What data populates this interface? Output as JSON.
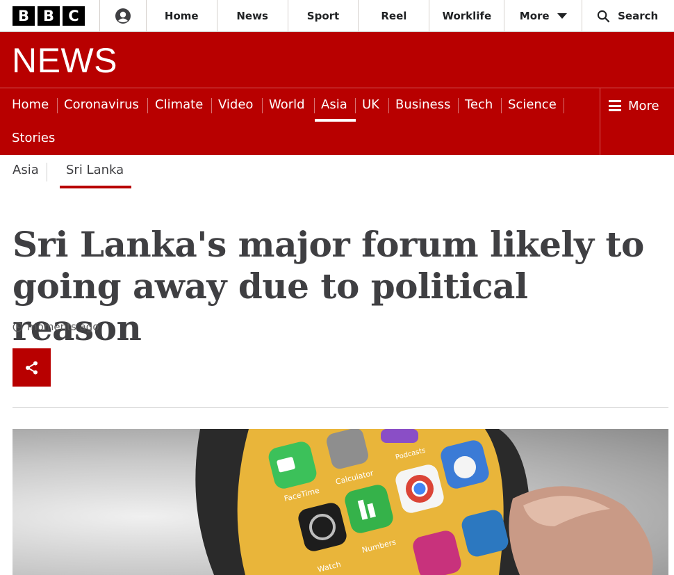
{
  "topbar": {
    "logo_letters": [
      "B",
      "B",
      "C"
    ],
    "nav": [
      "Home",
      "News",
      "Sport",
      "Reel",
      "Worklife",
      "More"
    ],
    "search_label": "Search"
  },
  "masthead": {
    "title": "NEWS"
  },
  "section_nav": {
    "items": [
      "Home",
      "Coronavirus",
      "Climate",
      "Video",
      "World",
      "Asia",
      "UK",
      "Business",
      "Tech",
      "Science",
      "Stories"
    ],
    "active": "Asia",
    "more_label": "More"
  },
  "sub_nav": {
    "items": [
      "Asia",
      "Sri Lanka"
    ],
    "active": "Sri Lanka"
  },
  "article": {
    "headline": "Sri Lanka's major forum likely to going away due to political reason",
    "timestamp": "moments ago"
  },
  "hero_image": {
    "app_labels": [
      "FaceTime",
      "Calculator",
      "Podcasts",
      "Numbers",
      "Watch"
    ]
  },
  "colors": {
    "brand_red": "#b80000",
    "text_dark": "#3f3f42",
    "divider": "#d5d0cd"
  }
}
